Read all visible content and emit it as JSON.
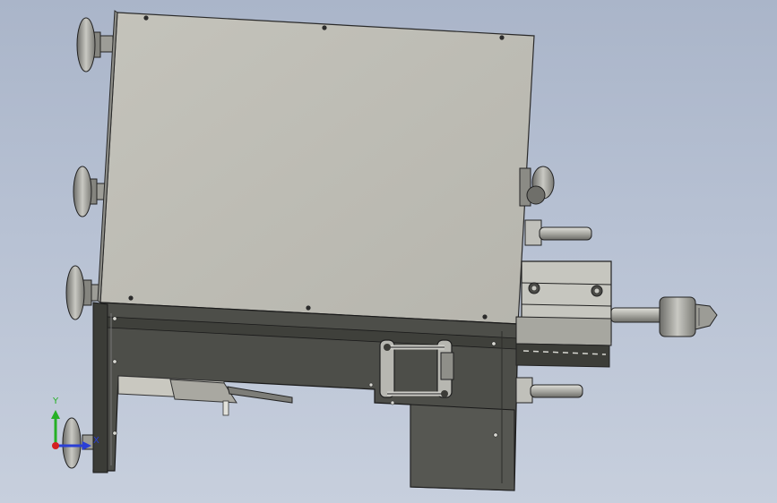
{
  "view": {
    "background": "#b4bfd1",
    "triad": {
      "y_label": "Y",
      "x_label": "X",
      "y_color": "#25b025",
      "x_color": "#2a3fd6",
      "z_color": "#d42020"
    },
    "colors": {
      "panel": "#bebdb5",
      "housing": "#4a4b46",
      "metal": "#a3a39d",
      "edge": "#1f1f1f"
    }
  }
}
